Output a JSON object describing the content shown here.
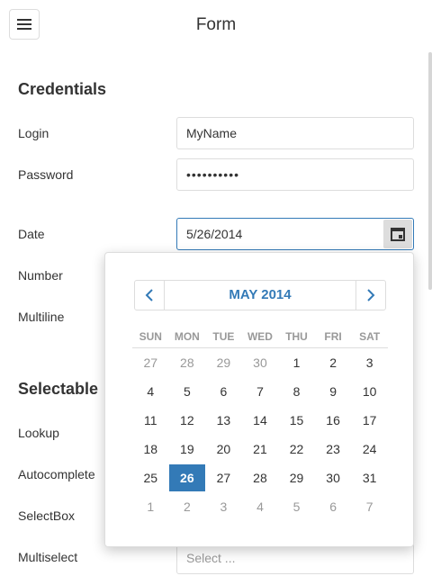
{
  "header": {
    "title": "Form",
    "menu_icon": "hamburger-icon"
  },
  "credentials": {
    "title": "Credentials",
    "login_label": "Login",
    "login_value": "MyName",
    "password_label": "Password",
    "password_value": "••••••••••",
    "date_label": "Date",
    "date_value": "5/26/2014",
    "number_label": "Number",
    "multiline_label": "Multiline"
  },
  "selectable": {
    "title": "Selectable",
    "lookup_label": "Lookup",
    "autocomplete_label": "Autocomplete",
    "selectbox_label": "SelectBox",
    "multiselect_label": "Multiselect",
    "multiselect_placeholder": "Select ..."
  },
  "calendar": {
    "caption": "MAY 2014",
    "weekdays": [
      "SUN",
      "MON",
      "TUE",
      "WED",
      "THU",
      "FRI",
      "SAT"
    ],
    "weeks": [
      [
        {
          "d": "27",
          "other": true
        },
        {
          "d": "28",
          "other": true
        },
        {
          "d": "29",
          "other": true
        },
        {
          "d": "30",
          "other": true
        },
        {
          "d": "1"
        },
        {
          "d": "2"
        },
        {
          "d": "3"
        }
      ],
      [
        {
          "d": "4"
        },
        {
          "d": "5"
        },
        {
          "d": "6"
        },
        {
          "d": "7"
        },
        {
          "d": "8"
        },
        {
          "d": "9"
        },
        {
          "d": "10"
        }
      ],
      [
        {
          "d": "11"
        },
        {
          "d": "12"
        },
        {
          "d": "13"
        },
        {
          "d": "14"
        },
        {
          "d": "15"
        },
        {
          "d": "16"
        },
        {
          "d": "17"
        }
      ],
      [
        {
          "d": "18"
        },
        {
          "d": "19"
        },
        {
          "d": "20"
        },
        {
          "d": "21"
        },
        {
          "d": "22"
        },
        {
          "d": "23"
        },
        {
          "d": "24"
        }
      ],
      [
        {
          "d": "25"
        },
        {
          "d": "26",
          "selected": true
        },
        {
          "d": "27"
        },
        {
          "d": "28"
        },
        {
          "d": "29"
        },
        {
          "d": "30"
        },
        {
          "d": "31"
        }
      ],
      [
        {
          "d": "1",
          "other": true
        },
        {
          "d": "2",
          "other": true
        },
        {
          "d": "3",
          "other": true
        },
        {
          "d": "4",
          "other": true
        },
        {
          "d": "5",
          "other": true
        },
        {
          "d": "6",
          "other": true
        },
        {
          "d": "7",
          "other": true
        }
      ]
    ]
  },
  "colors": {
    "accent": "#337ab7",
    "muted": "#999999",
    "border": "#dddddd"
  }
}
